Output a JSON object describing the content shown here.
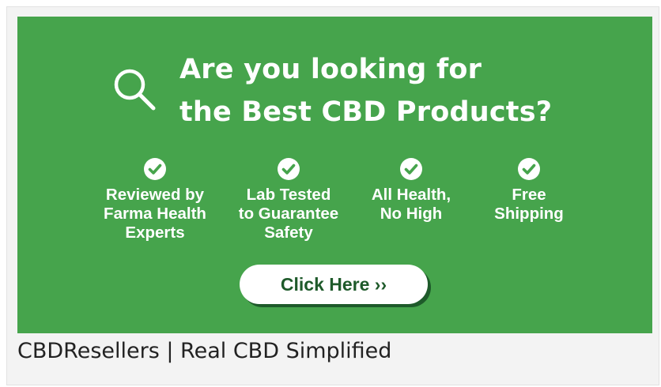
{
  "banner": {
    "headline_line1": "Are you looking for",
    "headline_line2": "the Best CBD Products?",
    "background_color": "#46a44c",
    "text_color": "#ffffff",
    "search_icon": "search-icon",
    "features": [
      {
        "icon": "check-circle-icon",
        "label": "Reviewed by\nFarma Health\nExperts"
      },
      {
        "icon": "check-circle-icon",
        "label": "Lab Tested\nto Guarantee\nSafety"
      },
      {
        "icon": "check-circle-icon",
        "label": "All Health,\nNo High"
      },
      {
        "icon": "check-circle-icon",
        "label": "Free\nShipping"
      }
    ],
    "cta": {
      "label": "Click Here ››",
      "text_color": "#1e5a2a",
      "background_color": "#ffffff"
    }
  },
  "caption": {
    "text": "CBDResellers | Real CBD Simplified"
  }
}
